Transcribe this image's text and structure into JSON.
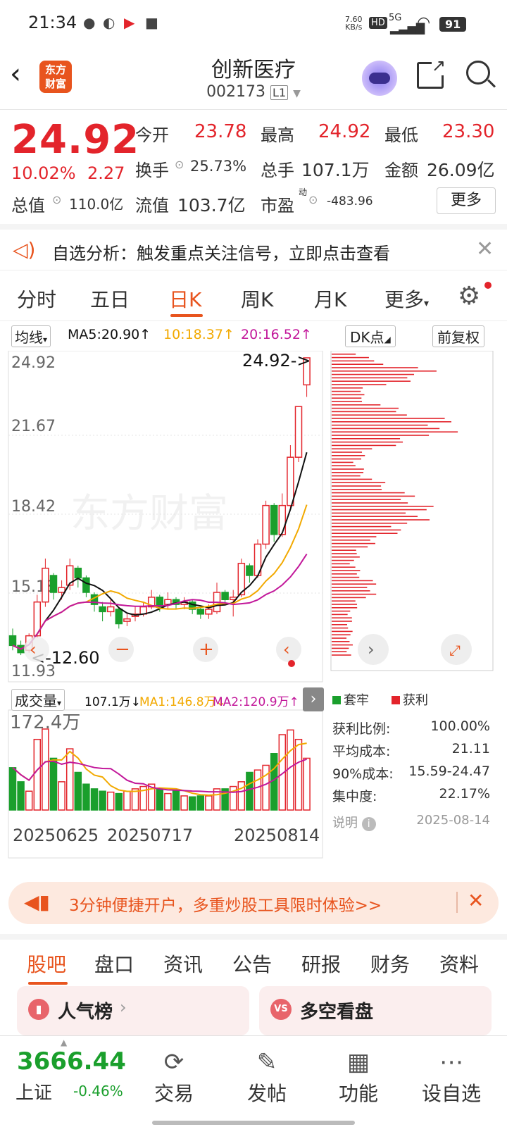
{
  "status": {
    "time": "21:34",
    "net_speed": "7.60",
    "net_unit": "KB/s",
    "hd": "HD",
    "signal": "5G",
    "battery": "91"
  },
  "header": {
    "title": "创新医疗",
    "code": "002173",
    "level": "L1",
    "logo_line1": "东方",
    "logo_line2": "财富"
  },
  "quote": {
    "price": "24.92",
    "change_pct": "10.02%",
    "change": "2.27",
    "open_label": "今开",
    "open": "23.78",
    "high_label": "最高",
    "high": "24.92",
    "low_label": "最低",
    "low": "23.30",
    "turnover_label": "换手",
    "turnover": "25.73%",
    "volume_label": "总手",
    "volume": "107.1万",
    "amount_label": "金额",
    "amount": "26.09亿",
    "mktcap_label": "总值",
    "mktcap": "110.0亿",
    "float_label": "流值",
    "float": "103.7亿",
    "pe_label": "市盈",
    "pe_sup": "动",
    "pe": "-483.96",
    "more_button": "更多"
  },
  "notice": {
    "text": "自选分析：触发重点关注信号，立即点击查看"
  },
  "tabs": [
    "分时",
    "五日",
    "日K",
    "周K",
    "月K",
    "更多"
  ],
  "chart_bar": {
    "ma_select": "均线",
    "ma5": "MA5:20.90↑",
    "ma10": "10:18.37↑",
    "ma20": "20:16.52↑",
    "dk": "DK点",
    "fq": "前复权"
  },
  "kline": {
    "y_labels": [
      "24.92",
      "21.67",
      "18.42",
      "15.18",
      "11.93"
    ],
    "max_note": "24.92->",
    "min_note": "<-12.60",
    "watermark": "东方财富"
  },
  "volume": {
    "select": "成交量",
    "vol": "107.1万↓",
    "ma1": "MA1:146.8万↓",
    "ma2": "MA2:120.9万↑",
    "max_label": "172.4万",
    "dates": [
      "20250625",
      "20250717",
      "20250814"
    ]
  },
  "chips": {
    "legend_trap": "套牢",
    "legend_profit": "获利",
    "rows": [
      {
        "label": "获利比例:",
        "value": "100.00%"
      },
      {
        "label": "平均成本:",
        "value": "21.11"
      },
      {
        "label": "90%成本:",
        "value": "15.59-24.47"
      },
      {
        "label": "集中度:",
        "value": "22.17%"
      }
    ],
    "note_label": "说明",
    "date": "2025-08-14"
  },
  "banner": {
    "text": "3分钟便捷开户，多重炒股工具限时体验>>"
  },
  "subtabs": [
    "股吧",
    "盘口",
    "资讯",
    "公告",
    "研报",
    "财务",
    "资料"
  ],
  "cards": {
    "left": "人气榜",
    "right": "多空看盘"
  },
  "index": {
    "value": "3666.44",
    "name": "上证",
    "change": "-0.46%"
  },
  "nav": [
    "交易",
    "发帖",
    "功能",
    "设自选"
  ],
  "colors": {
    "up": "#e3242b",
    "down": "#1a9f2c",
    "accent": "#e8541e",
    "ma5": "#111111",
    "ma10": "#f2a900",
    "ma20": "#c2179a"
  }
}
